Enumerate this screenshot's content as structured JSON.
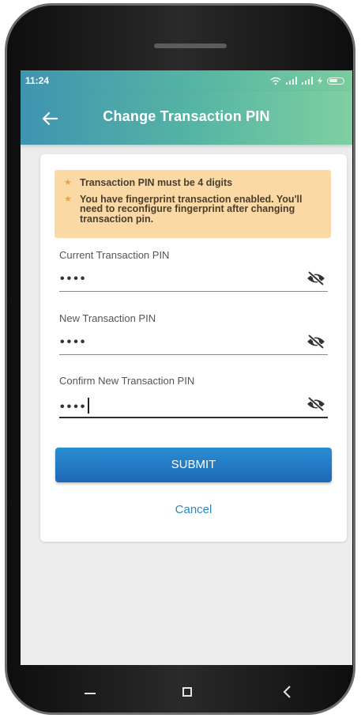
{
  "status_bar": {
    "time": "11:24"
  },
  "app_bar": {
    "title": "Change Transaction PIN",
    "back_icon": "arrow-left-icon"
  },
  "notice": {
    "items": [
      "Transaction PIN must be 4 digits",
      "You have fingerprint transaction enabled. You'll need to reconfigure fingerprint after changing transaction pin."
    ],
    "background": "#fad9a4",
    "icon": "star-icon"
  },
  "fields": [
    {
      "label": "Current Transaction PIN",
      "value": "••••",
      "toggle_icon": "eye-slash-icon"
    },
    {
      "label": "New Transaction PIN",
      "value": "••••",
      "toggle_icon": "eye-slash-icon"
    },
    {
      "label": "Confirm New Transaction PIN",
      "value": "••••",
      "toggle_icon": "eye-slash-icon"
    }
  ],
  "actions": {
    "submit_label": "SUBMIT",
    "cancel_label": "Cancel"
  },
  "colors": {
    "header_start": "#3f94b0",
    "header_end": "#7fd0a1",
    "submit": "#1e7fd0",
    "link": "#2e86b8"
  }
}
